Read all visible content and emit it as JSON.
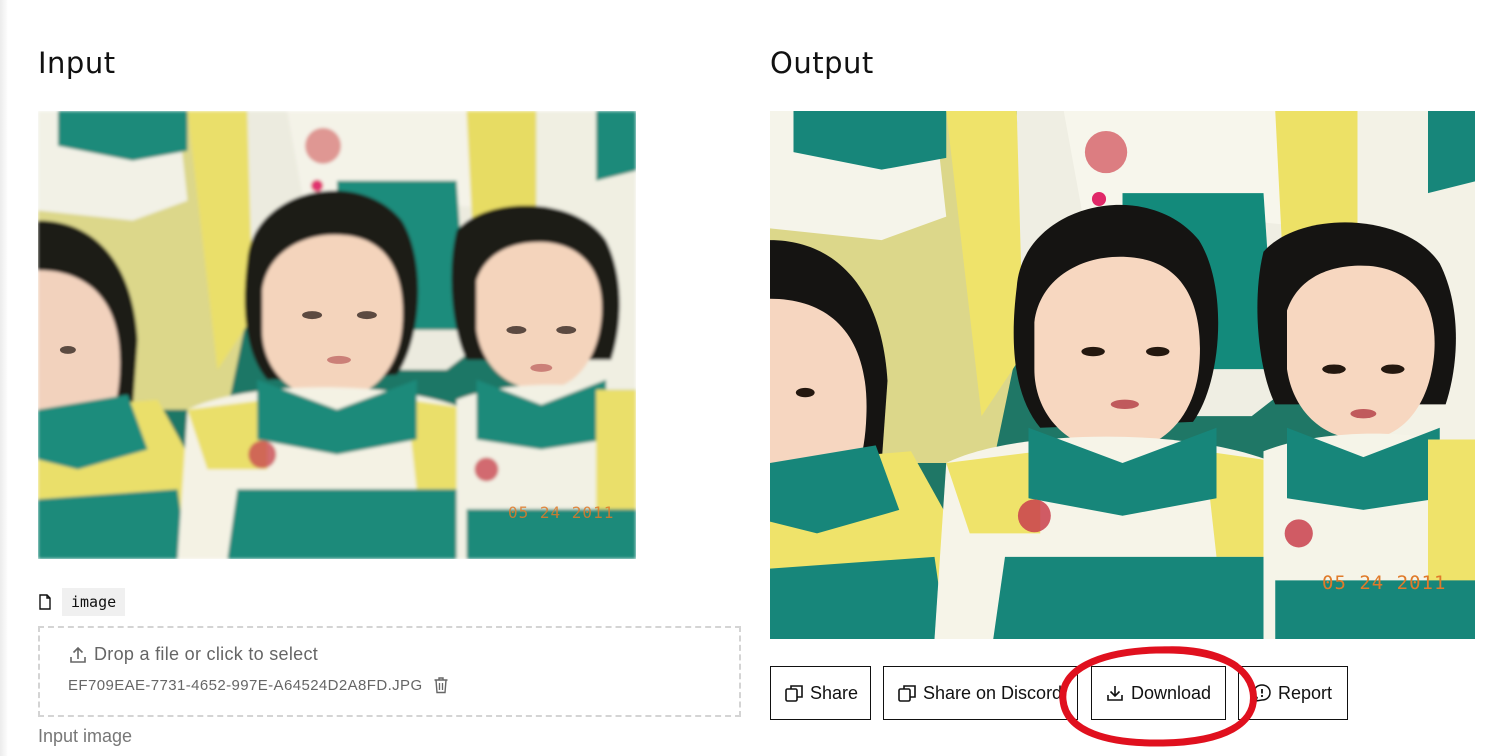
{
  "input_panel": {
    "heading": "Input",
    "field_name": "image",
    "dropzone_prompt": "Drop a file or click to select",
    "filename": "EF709EAE-7731-4652-997E-A64524D2A8FD.JPG",
    "caption": "Input image",
    "photo_date_stamp": "05 24 2011"
  },
  "output_panel": {
    "heading": "Output",
    "photo_date_stamp": "05 24 2011"
  },
  "actions": {
    "share": "Share",
    "share_discord": "Share on Discord",
    "download": "Download",
    "report": "Report"
  },
  "colors": {
    "teal": "#1e8a7a",
    "shirt_yellow": "#eadf6a",
    "annotation_red": "#e0101e",
    "button_border": "#111111"
  }
}
